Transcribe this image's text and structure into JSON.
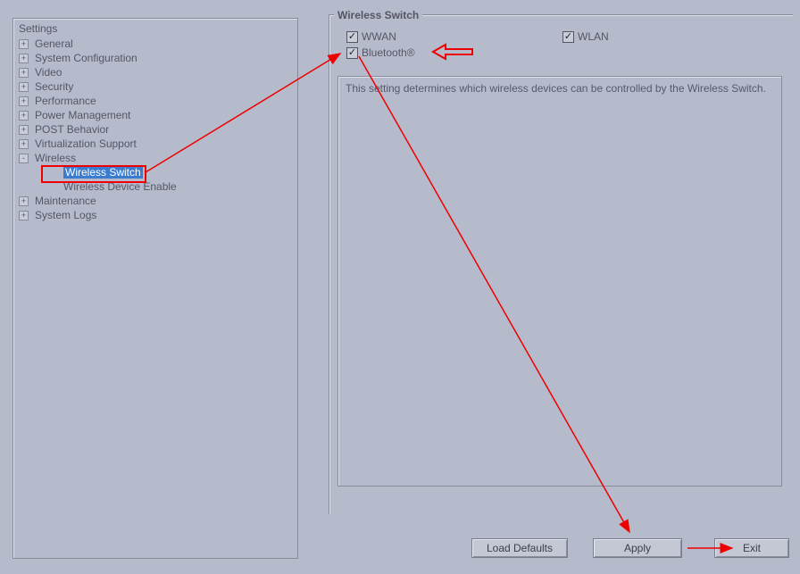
{
  "sidebar": {
    "title": "Settings",
    "items": [
      {
        "label": "General",
        "expander": "+"
      },
      {
        "label": "System Configuration",
        "expander": "+"
      },
      {
        "label": "Video",
        "expander": "+"
      },
      {
        "label": "Security",
        "expander": "+"
      },
      {
        "label": "Performance",
        "expander": "+"
      },
      {
        "label": "Power Management",
        "expander": "+"
      },
      {
        "label": "POST Behavior",
        "expander": "+"
      },
      {
        "label": "Virtualization Support",
        "expander": "+"
      },
      {
        "label": "Wireless",
        "expander": "-"
      },
      {
        "label": "Maintenance",
        "expander": "+"
      },
      {
        "label": "System Logs",
        "expander": "+"
      }
    ],
    "wireless_children": [
      {
        "label": "Wireless Switch",
        "selected": true
      },
      {
        "label": "Wireless Device Enable",
        "selected": false
      }
    ]
  },
  "panel": {
    "title": "Wireless Switch",
    "checkboxes": {
      "wwan": "WWAN",
      "wlan": "WLAN",
      "bluetooth": "Bluetooth®"
    },
    "description": "This setting determines which wireless devices can be controlled by the Wireless Switch."
  },
  "buttons": {
    "load_defaults": "Load Defaults",
    "apply": "Apply",
    "exit": "Exit"
  }
}
